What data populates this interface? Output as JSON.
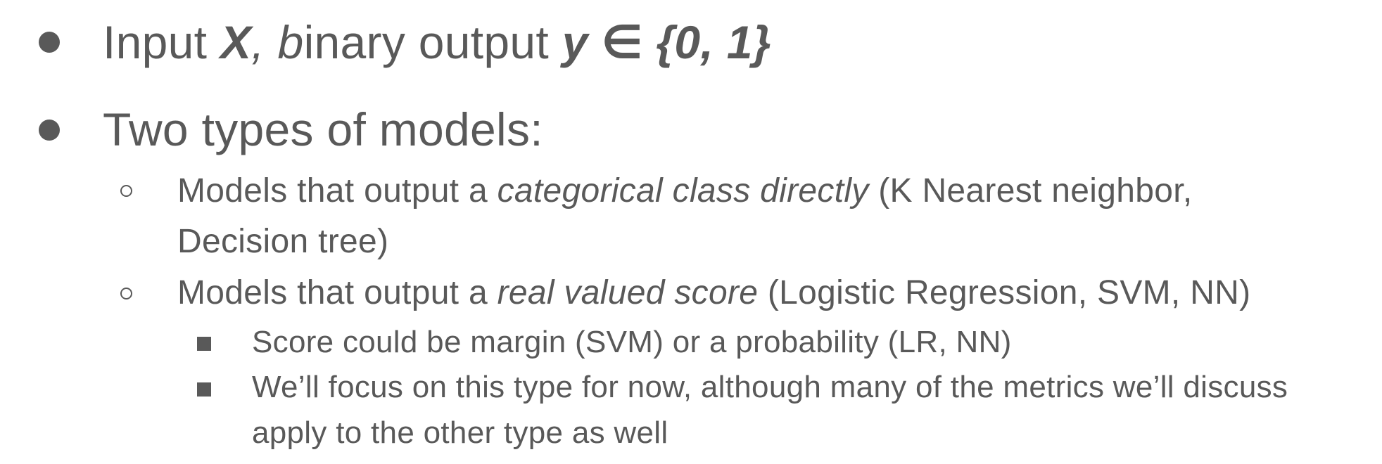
{
  "bullets": {
    "b1": {
      "p1": "Input ",
      "p2": "X",
      "p3": ", ",
      "p4": "b",
      "p5": "inary output ",
      "p6": "y ∈ {0, 1}"
    },
    "b2": {
      "text": "Two types of models:"
    },
    "b2_1": {
      "p1": "Models that output a ",
      "p2": "categorical class directly",
      "p3": " (K Nearest neighbor,",
      "line2": "Decision tree)"
    },
    "b2_2": {
      "p1": "Models that output a ",
      "p2": "real valued score",
      "p3": " (Logistic Regression, SVM, NN)"
    },
    "b2_2_1": {
      "text": "Score could be margin (SVM) or a probability (LR, NN)"
    },
    "b2_2_2": {
      "line1": "We’ll focus on this type for now, although many of the metrics we’ll discuss",
      "line2": "apply to the other type as well"
    }
  },
  "colors": {
    "text": "#595959",
    "background": "#ffffff"
  }
}
